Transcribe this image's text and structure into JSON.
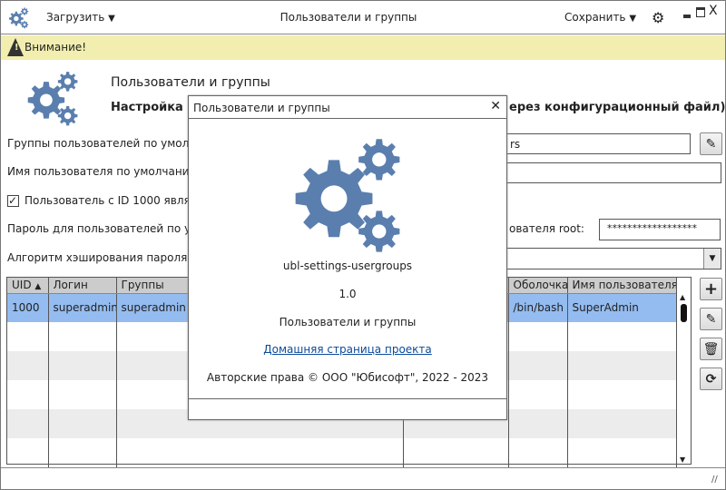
{
  "header": {
    "load_label": "Загрузить",
    "title": "Пользователи и группы",
    "save_label": "Сохранить"
  },
  "warning": {
    "text": "Внимание!"
  },
  "intro": {
    "title": "Пользователи и группы",
    "subtitle_left": "Настройка по",
    "subtitle_right": "ерез конфигурационный файл)"
  },
  "form": {
    "groups_label": "Группы пользователей по умолчан",
    "groups_value": "rs",
    "username_label": "Имя пользователя по умолчанию (",
    "uid_checkbox_label": "Пользователь с ID 1000 являет",
    "password_label": "Пароль для пользователей по умо",
    "root_label": "ователя root:",
    "root_password": "******************",
    "hash_label": "Алгоритм хэширования пароля:"
  },
  "table": {
    "columns": [
      "UID",
      "Логин",
      "Группы",
      "",
      "Оболочка",
      "Имя пользователя"
    ],
    "rows": [
      {
        "uid": "1000",
        "login": "superadmin",
        "groups": "superadmin",
        "shell": "/bin/bash",
        "name": "SuperAdmin"
      }
    ]
  },
  "dialog": {
    "title": "Пользователи и группы",
    "app_name": "ubl-settings-usergroups",
    "version": "1.0",
    "description": "Пользователи и группы",
    "link": "Домашняя страница проекта",
    "copyright": "Авторские права © ООО \"Юбисофт\", 2022 - 2023"
  },
  "colors": {
    "accent": "#5a7fae",
    "warning": "#f2eeb0",
    "selected_row": "#94bcf0",
    "link": "#0b4a9a"
  }
}
